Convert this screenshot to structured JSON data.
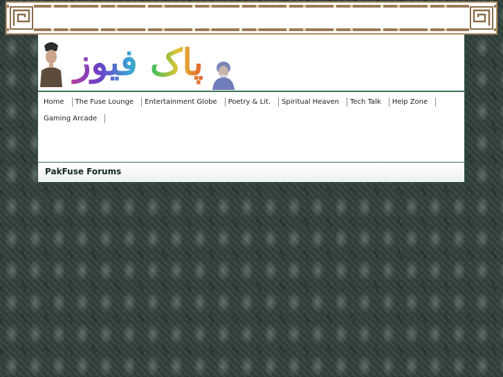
{
  "header": {
    "logo_text": "پاک فیوز"
  },
  "nav": {
    "items": [
      {
        "label": "Home"
      },
      {
        "label": "The Fuse Lounge"
      },
      {
        "label": "Entertainment Globe"
      },
      {
        "label": "Poetry & Lit."
      },
      {
        "label": "Spiritual Heaven"
      },
      {
        "label": "Tech Talk"
      },
      {
        "label": "Help Zone"
      },
      {
        "label": "Gaming Arcade"
      }
    ]
  },
  "page": {
    "title": "PakFuse Forums"
  },
  "colors": {
    "background": "#33413d",
    "frame": "#b08f62",
    "accent": "#3b6e54",
    "title_text": "#12291d"
  },
  "icons": {
    "corner_ornament": "greek-key-corner-icon",
    "left_portrait": "portrait-image",
    "right_portrait": "portrait-image"
  }
}
